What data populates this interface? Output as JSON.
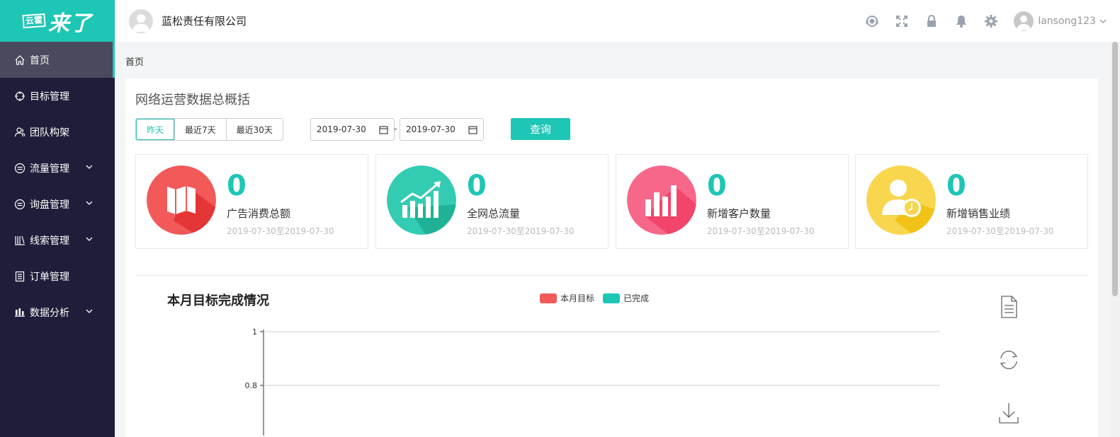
{
  "logo": {
    "small": "云霍",
    "big": "来了"
  },
  "sidebar": {
    "items": [
      {
        "label": "首页",
        "icon": "home-icon"
      },
      {
        "label": "目标管理",
        "icon": "target-icon"
      },
      {
        "label": "团队构架",
        "icon": "team-icon"
      },
      {
        "label": "流量管理",
        "icon": "traffic-icon"
      },
      {
        "label": "询盘管理",
        "icon": "inquiry-icon"
      },
      {
        "label": "线索管理",
        "icon": "leads-icon"
      },
      {
        "label": "订单管理",
        "icon": "order-icon"
      },
      {
        "label": "数据分析",
        "icon": "analytics-icon"
      }
    ]
  },
  "header": {
    "company": "蓝松责任有限公司",
    "username": "lansong123"
  },
  "breadcrumb": "首页",
  "panel": {
    "title": "网络运营数据总概括",
    "ranges": [
      "昨天",
      "最近7天",
      "最近30天"
    ],
    "start_date": "2019-07-30",
    "end_date": "2019-07-30",
    "separator": "-",
    "query": "查询"
  },
  "stats": [
    {
      "value": "0",
      "label": "广告消费总额",
      "date": "2019-07-30至2019-07-30",
      "color": "#f15a59"
    },
    {
      "value": "0",
      "label": "全网总流量",
      "date": "2019-07-30至2019-07-30",
      "color": "#20c9a6"
    },
    {
      "value": "0",
      "label": "新增客户数量",
      "date": "2019-07-30至2019-07-30",
      "color": "#f75b7c"
    },
    {
      "value": "0",
      "label": "新增销售业绩",
      "date": "2019-07-30至2019-07-30",
      "color": "#f7cf3e"
    }
  ],
  "chart_data": {
    "type": "bar",
    "title": "本月目标完成情况",
    "series": [
      {
        "name": "本月目标",
        "color": "#f15a59",
        "values": []
      },
      {
        "name": "已完成",
        "color": "#1ec6b6",
        "values": []
      }
    ],
    "y_ticks": [
      "1",
      "0.8"
    ],
    "ylim": [
      0,
      1
    ],
    "grid": true,
    "legend_position": "top-center"
  }
}
